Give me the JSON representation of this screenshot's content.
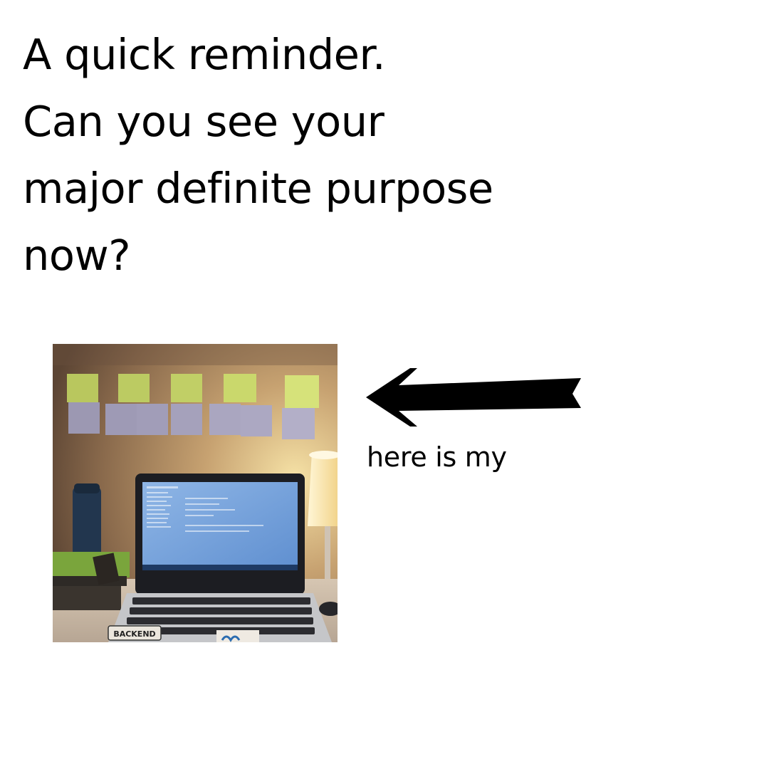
{
  "headline": {
    "lines": [
      "A quick reminder.",
      "Can you see your",
      "major definite purpose",
      "now?"
    ]
  },
  "photo": {
    "sticker_text": "BACKEND"
  },
  "arrow": {
    "icon": "left-arrow-icon",
    "color": "#000000"
  },
  "caption": {
    "text": "here is my"
  },
  "colors": {
    "background": "#ffffff",
    "text": "#000000",
    "sticky_green": "#c9d66a",
    "sticky_lavender": "#a9a6bd",
    "screen_blue": "#6f9fd8"
  }
}
